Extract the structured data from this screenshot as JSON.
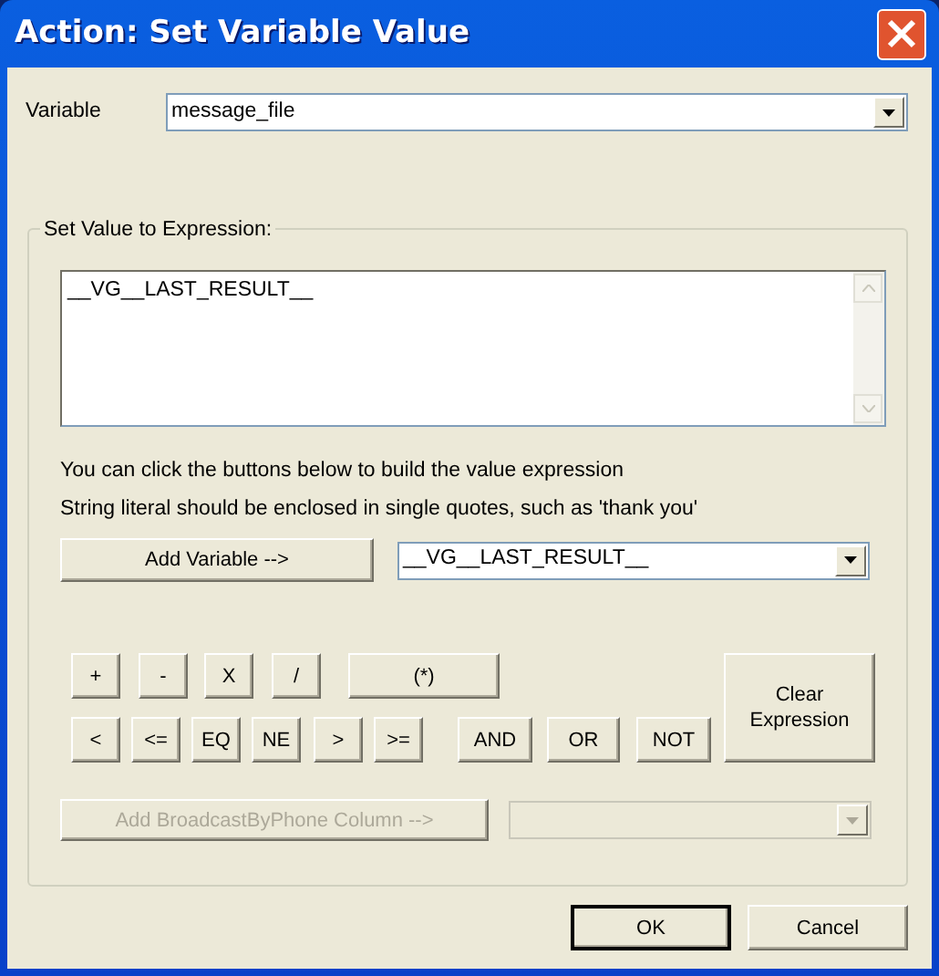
{
  "window": {
    "title": "Action: Set Variable Value"
  },
  "variable": {
    "label": "Variable",
    "value": "message_file"
  },
  "expression_group": {
    "legend": "Set Value to Expression:",
    "expression": "__VG__LAST_RESULT__",
    "hints": [
      "You can click the buttons below to build the value expression",
      "String literal should be enclosed in single quotes, such as 'thank you'"
    ],
    "add_variable_button": {
      "label": "Add Variable -->",
      "disabled": false
    },
    "variable_combo": {
      "value": "__VG__LAST_RESULT__",
      "disabled": false
    },
    "operator_rows": [
      [
        "+",
        "-",
        "X",
        "/",
        "(*)"
      ],
      [
        "<",
        "<=",
        "EQ",
        "NE",
        ">",
        ">=",
        "AND",
        "OR",
        "NOT"
      ]
    ],
    "clear_button": {
      "label": "Clear\nExpression"
    },
    "column_button": {
      "label": "Add BroadcastByPhone Column -->",
      "disabled": true
    },
    "column_combo": {
      "disabled": true
    }
  },
  "buttons": [
    {
      "label": "OK",
      "default": true
    },
    {
      "label": "Cancel",
      "default": false
    }
  ]
}
